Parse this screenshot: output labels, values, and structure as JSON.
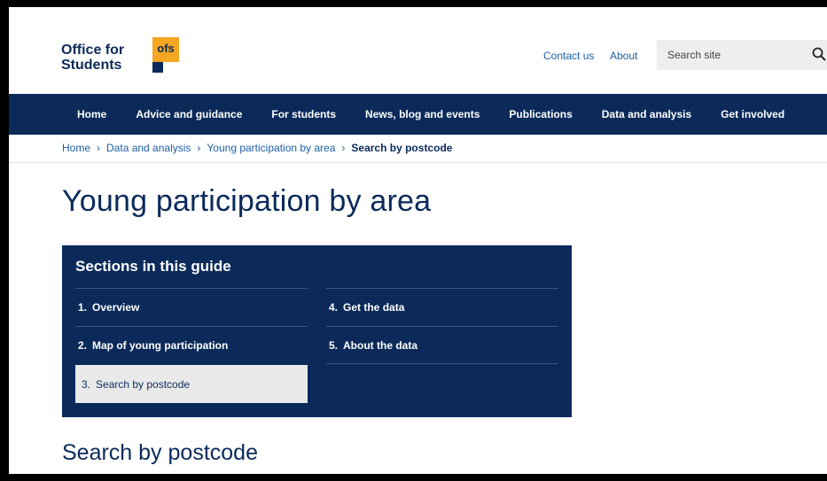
{
  "header": {
    "logo_text_line1": "Office for",
    "logo_text_line2": "Students",
    "logo_badge": "ofs",
    "contact_label": "Contact us",
    "about_label": "About",
    "search_placeholder": "Search site",
    "search_icon": "search-icon"
  },
  "nav": {
    "items": [
      {
        "label": "Home"
      },
      {
        "label": "Advice and guidance"
      },
      {
        "label": "For students"
      },
      {
        "label": "News, blog and events"
      },
      {
        "label": "Publications"
      },
      {
        "label": "Data and analysis"
      },
      {
        "label": "Get involved"
      }
    ]
  },
  "breadcrumb": {
    "items": [
      "Home",
      "Data and analysis",
      "Young participation by area"
    ],
    "current": "Search by postcode"
  },
  "page": {
    "title": "Young participation by area",
    "section_title": "Search by postcode"
  },
  "guide": {
    "heading": "Sections in this guide",
    "left": [
      {
        "num": "1.",
        "label": "Overview"
      },
      {
        "num": "2.",
        "label": "Map of young participation"
      },
      {
        "num": "3.",
        "label": "Search by postcode"
      }
    ],
    "right": [
      {
        "num": "4.",
        "label": "Get the data"
      },
      {
        "num": "5.",
        "label": "About the data"
      }
    ]
  },
  "colors": {
    "navy": "#0b2a5a",
    "orange": "#f5a623",
    "link": "#1d5fa6"
  }
}
